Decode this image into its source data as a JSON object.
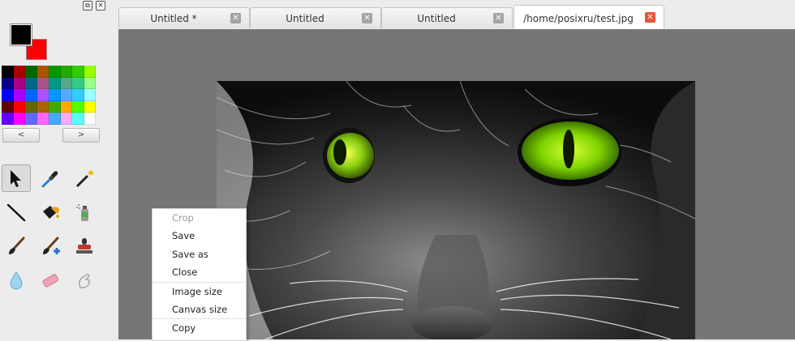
{
  "window": {
    "dock_float_icon": "float-icon",
    "dock_close_icon": "close-icon"
  },
  "colors": {
    "foreground": "#000000",
    "background": "#ff0000",
    "palette": [
      "#000000",
      "#aa0000",
      "#006600",
      "#aa5500",
      "#009900",
      "#22aa00",
      "#33cc00",
      "#99ff00",
      "#000088",
      "#aa0088",
      "#006688",
      "#aa5588",
      "#009988",
      "#55aa88",
      "#33cc88",
      "#99ff88",
      "#0000ff",
      "#aa00ff",
      "#0066ff",
      "#aa55ff",
      "#0099ff",
      "#55aaff",
      "#33ccff",
      "#99ffff",
      "#660000",
      "#ff0000",
      "#666600",
      "#aa6600",
      "#44aa00",
      "#ffaa00",
      "#55ff00",
      "#ffff00",
      "#6600ff",
      "#ff00ff",
      "#6666ff",
      "#ff66ff",
      "#44aaff",
      "#ffaaff",
      "#55ffff",
      "#ffffff"
    ],
    "prev_label": "<",
    "next_label": ">"
  },
  "tools": [
    {
      "name": "select-tool",
      "icon": "arrow-pointer-icon",
      "active": true
    },
    {
      "name": "color-picker-tool",
      "icon": "eyedropper-icon"
    },
    {
      "name": "magic-wand-tool",
      "icon": "magic-wand-icon"
    },
    {
      "name": "line-tool",
      "icon": "line-icon"
    },
    {
      "name": "fill-tool",
      "icon": "paint-bucket-icon"
    },
    {
      "name": "spray-tool",
      "icon": "spray-can-icon"
    },
    {
      "name": "brush-tool",
      "icon": "brush-icon"
    },
    {
      "name": "clone-brush-tool",
      "icon": "brush-plus-icon"
    },
    {
      "name": "stamp-tool",
      "icon": "stamp-icon"
    },
    {
      "name": "blur-tool",
      "icon": "water-drop-icon"
    },
    {
      "name": "eraser-tool",
      "icon": "eraser-icon"
    },
    {
      "name": "smudge-tool",
      "icon": "finger-icon"
    }
  ],
  "tabs": [
    {
      "label": "Untitled *",
      "active": false
    },
    {
      "label": "Untitled",
      "active": false
    },
    {
      "label": "Untitled",
      "active": false
    },
    {
      "label": "/home/posixru/test.jpg",
      "active": true
    }
  ],
  "context_menu": {
    "items": [
      {
        "label": "Crop",
        "enabled": false
      },
      {
        "label": "Save",
        "enabled": true
      },
      {
        "label": "Save as",
        "enabled": true
      },
      {
        "label": "Close",
        "enabled": true
      },
      {
        "label": "Image size",
        "enabled": true,
        "separator_before": true
      },
      {
        "label": "Canvas size",
        "enabled": true
      },
      {
        "label": "Copy",
        "enabled": true,
        "separator_before": true
      }
    ]
  }
}
